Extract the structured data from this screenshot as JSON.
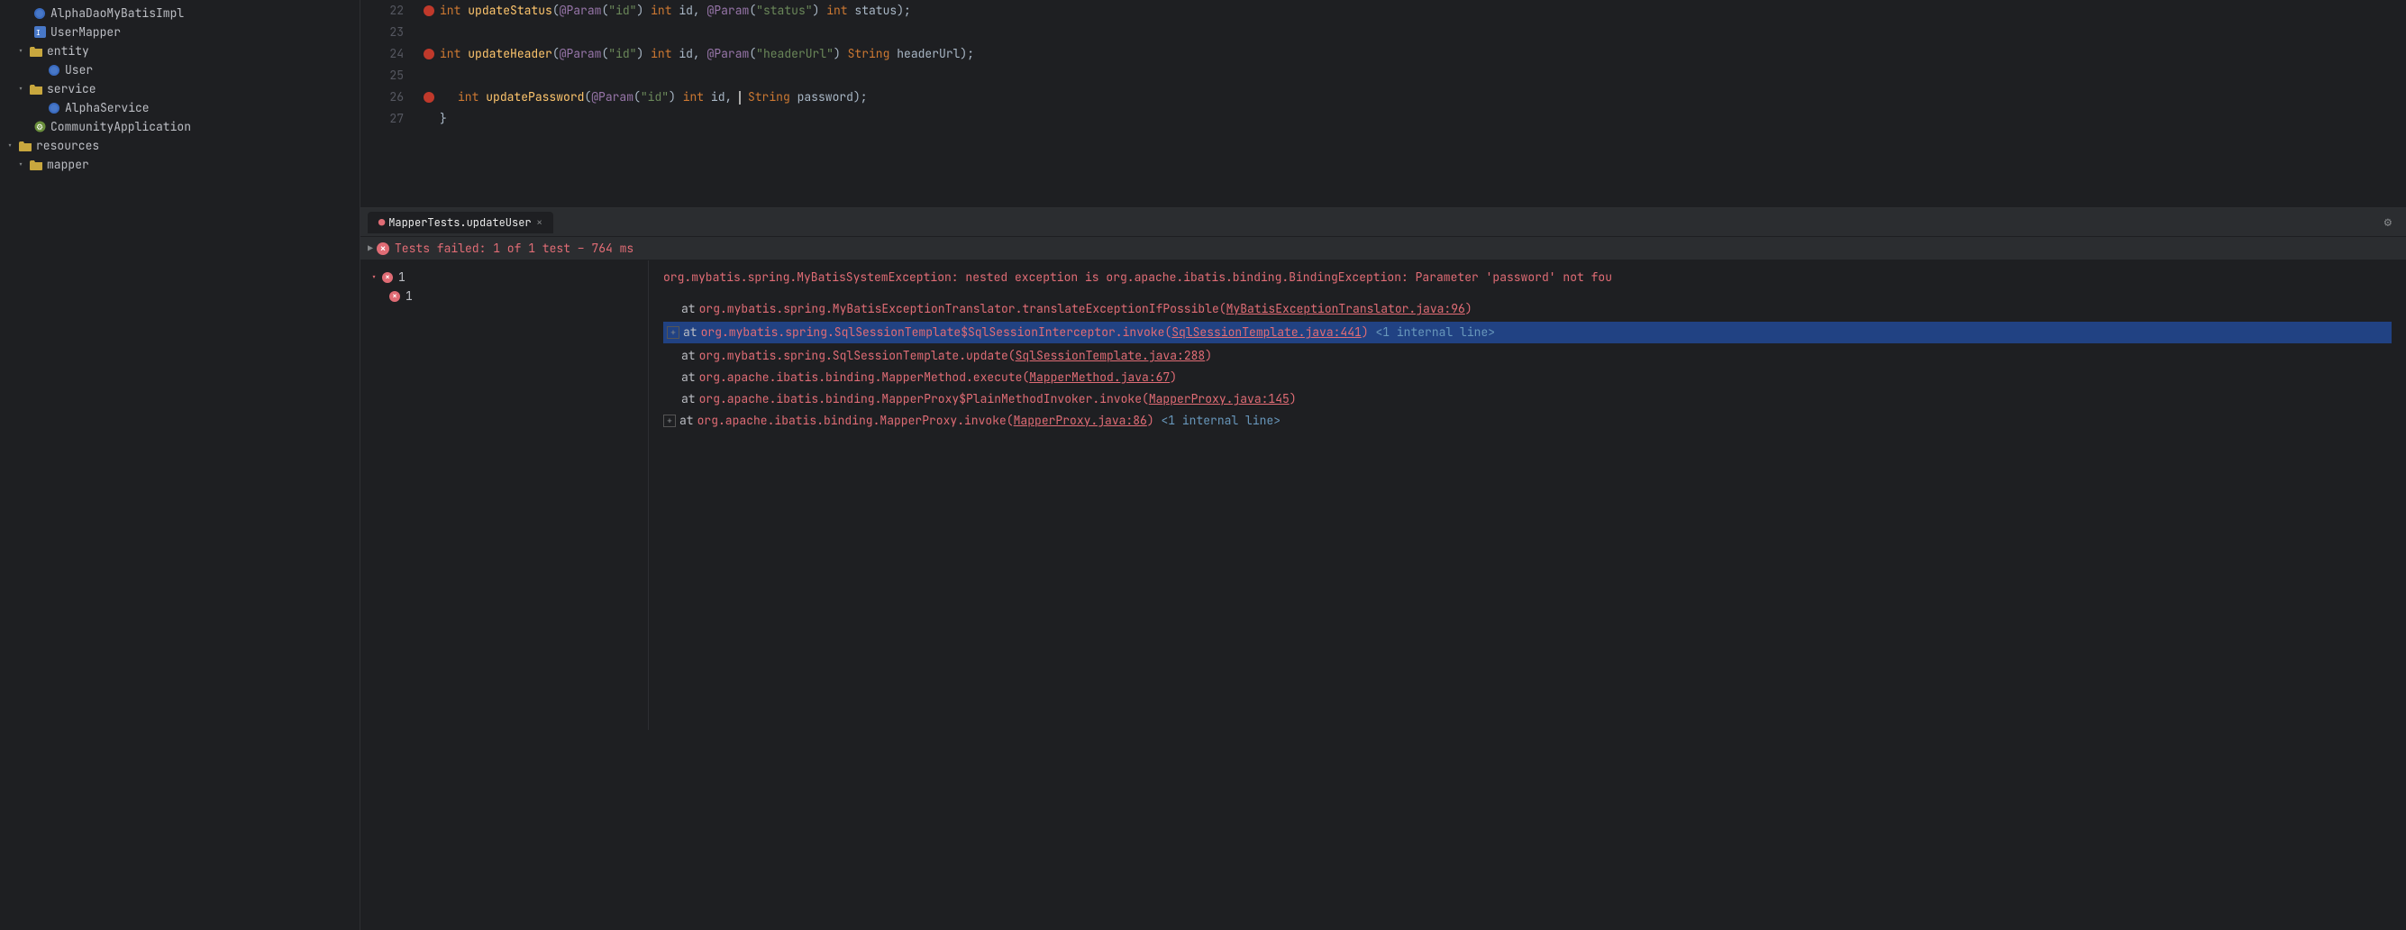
{
  "sidebar": {
    "items": [
      {
        "label": "AlphaDaoMyBatisImpl",
        "type": "java",
        "indent": 2,
        "expanded": false
      },
      {
        "label": "UserMapper",
        "type": "interface",
        "indent": 2,
        "expanded": false
      },
      {
        "label": "entity",
        "type": "folder",
        "indent": 1,
        "expanded": true
      },
      {
        "label": "User",
        "type": "java",
        "indent": 3,
        "expanded": false
      },
      {
        "label": "service",
        "type": "folder",
        "indent": 1,
        "expanded": true
      },
      {
        "label": "AlphaService",
        "type": "java",
        "indent": 3,
        "expanded": false
      },
      {
        "label": "CommunityApplication",
        "type": "java-orange",
        "indent": 2,
        "expanded": false
      },
      {
        "label": "resources",
        "type": "folder-root",
        "indent": 0,
        "expanded": true
      },
      {
        "label": "mapper",
        "type": "folder",
        "indent": 1,
        "expanded": false
      }
    ]
  },
  "editor": {
    "lines": [
      {
        "num": 22,
        "hasBreakpoint": true,
        "content": "int updateStatus(@Param(\"id\") int id, @Param(\"status\") int status);"
      },
      {
        "num": 23,
        "hasBreakpoint": false,
        "content": ""
      },
      {
        "num": 24,
        "hasBreakpoint": true,
        "content": "int updateHeader(@Param(\"id\") int id, @Param(\"headerUrl\") String headerUrl);"
      },
      {
        "num": 25,
        "hasBreakpoint": false,
        "content": ""
      },
      {
        "num": 26,
        "hasBreakpoint": true,
        "content": "    int updatePassword(@Param(\"id\") int id, | String password);"
      },
      {
        "num": 27,
        "hasBreakpoint": false,
        "content": "}"
      }
    ]
  },
  "bottomPanel": {
    "tabs": [
      {
        "label": "MapperTests.updateUser",
        "active": true
      }
    ],
    "testHeader": {
      "arrow": "▶",
      "statusIcon": "✕",
      "statusText": "Tests failed: 1 of 1 test – 764 ms"
    },
    "testTree": {
      "items": [
        {
          "num": "1",
          "indent": 0
        },
        {
          "num": "1",
          "indent": 1
        }
      ]
    },
    "errorOutput": {
      "mainError": "org.mybatis.spring.MyBatisSystemException: nested exception is org.apache.ibatis.binding.BindingException: Parameter 'password' not fou",
      "stackLines": [
        {
          "type": "normal",
          "text": "at org.mybatis.spring.MyBatisExceptionTranslator.translateExceptionIfPossible(",
          "link": "MyBatisExceptionTranslator.java:96",
          "suffix": ")"
        },
        {
          "type": "highlighted",
          "text": "at org.mybatis.spring.SqlSessionTemplate$SqlSessionInterceptor.invoke(",
          "link": "SqlSessionTemplate.java:441",
          "suffix": ") <1 internal line>"
        },
        {
          "type": "normal",
          "text": "at org.mybatis.spring.SqlSessionTemplate.update(",
          "link": "SqlSessionTemplate.java:288",
          "suffix": ")"
        },
        {
          "type": "normal",
          "text": "at org.apache.ibatis.binding.MapperMethod.execute(",
          "link": "MapperMethod.java:67",
          "suffix": ")"
        },
        {
          "type": "normal",
          "text": "at org.apache.ibatis.binding.MapperProxy$PlainMethodInvoker.invoke(",
          "link": "MapperProxy.java:145",
          "suffix": ")"
        },
        {
          "type": "normal",
          "text": "at org.apache.ibatis.binding.MapperProxy.invoke(",
          "link": "MapperProxy.java:86",
          "suffix": ") <1 internal line>"
        }
      ]
    }
  }
}
